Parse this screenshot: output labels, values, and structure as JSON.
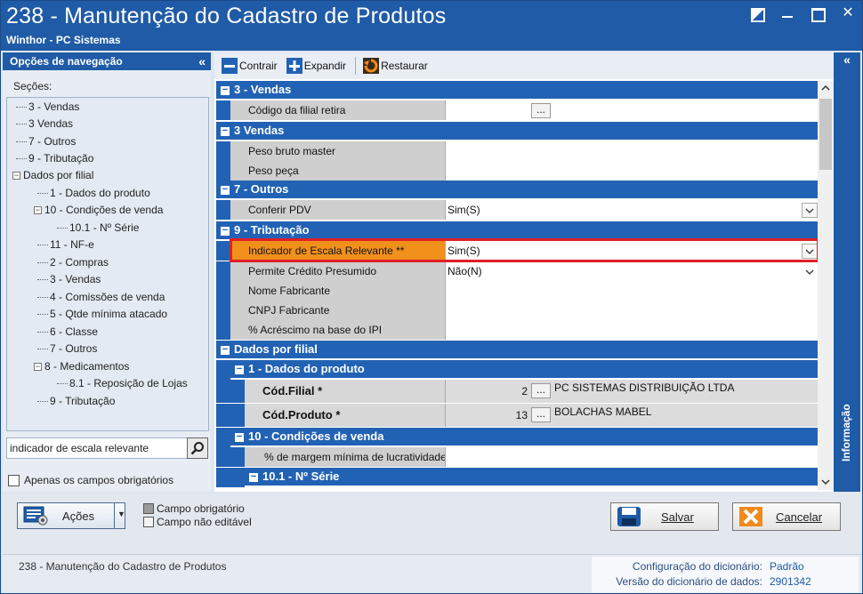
{
  "window": {
    "title": "238 - Manutenção do Cadastro de Produtos",
    "subtitle": "Winthor - PC Sistemas"
  },
  "nav": {
    "header": "Opções de navegação",
    "collapse_glyph": "«",
    "sections_label": "Seções:",
    "tree": [
      {
        "label": "3 - Vendas"
      },
      {
        "label": "3 Vendas"
      },
      {
        "label": "7 - Outros"
      },
      {
        "label": "9 - Tributação"
      },
      {
        "label": "Dados por filial"
      },
      {
        "label": "1 - Dados do produto"
      },
      {
        "label": "10 - Condições de venda"
      },
      {
        "label": "10.1 - Nº Série"
      },
      {
        "label": "11 - NF-e"
      },
      {
        "label": "2 - Compras"
      },
      {
        "label": "3 - Vendas"
      },
      {
        "label": "4 - Comissões de venda"
      },
      {
        "label": "5 - Qtde mínima atacado"
      },
      {
        "label": "6 - Classe"
      },
      {
        "label": "7 - Outros"
      },
      {
        "label": "8 - Medicamentos"
      },
      {
        "label": "8.1 -  Reposição de Lojas"
      },
      {
        "label": "9 - Tributação"
      }
    ],
    "search_value": "indicador de escala relevante",
    "required_only_label": "Apenas os campos obrigatórios"
  },
  "toolbar": {
    "collapse_label": "Contrair",
    "expand_label": "Expandir",
    "restore_label": "Restaurar"
  },
  "grid": {
    "cat_3_vendas": "3 - Vendas",
    "row_codigo_filial": "Código da filial retira",
    "cat_3vendas": "3 Vendas",
    "row_peso_bruto": "Peso bruto master",
    "row_peso_peca": "Peso peça",
    "cat_7_outros": "7 - Outros",
    "row_conferir_pdv": "Conferir PDV",
    "val_conferir_pdv": "Sim(S)",
    "cat_9_tributacao": "9 - Tributação",
    "row_indicador": "Indicador de Escala Relevante **",
    "val_indicador": "Sim(S)",
    "row_credito": "Permite Crédito Presumido",
    "val_credito": "Não(N)",
    "row_nome_fab": "Nome Fabricante",
    "row_cnpj_fab": "CNPJ Fabricante",
    "row_acrescimo": "% Acréscimo na base do IPI",
    "cat_dados_filial": "Dados por filial",
    "cat_dados_produto": "1 - Dados do produto",
    "row_cod_filial": "Cód.Filial *",
    "val_cod_filial": "2",
    "desc_cod_filial": "PC SISTEMAS DISTRIBUIÇÃO LTDA",
    "row_cod_produto": "Cód.Produto *",
    "val_cod_produto": "13",
    "desc_cod_produto": "BOLACHAS MABEL",
    "cat_condicoes": "10 - Condições de venda",
    "row_margem": "% de margem mínima de lucratividade",
    "cat_serie": "10.1 - Nº Série",
    "ellipsis": "..."
  },
  "info_tab": {
    "label": "Informação",
    "chevron": "«"
  },
  "actions": {
    "acoes_label": "Ações",
    "legend_required": "Campo obrigatório",
    "legend_readonly": "Campo não editável",
    "save_label": "Salvar",
    "cancel_label": "Cancelar"
  },
  "status": {
    "screen_name": "238 - Manutenção do Cadastro de Produtos",
    "dict_config_label": "Configuração do dicionário:",
    "dict_config_value": "Padrão",
    "dict_version_label": "Versão do dicionário de dados:",
    "dict_version_value": "2901342"
  },
  "colors": {
    "titlebar": "#1f5ba6",
    "category_row": "#2262b4",
    "highlight_border": "#e01f26",
    "label_cell": "#cfcfcf"
  }
}
